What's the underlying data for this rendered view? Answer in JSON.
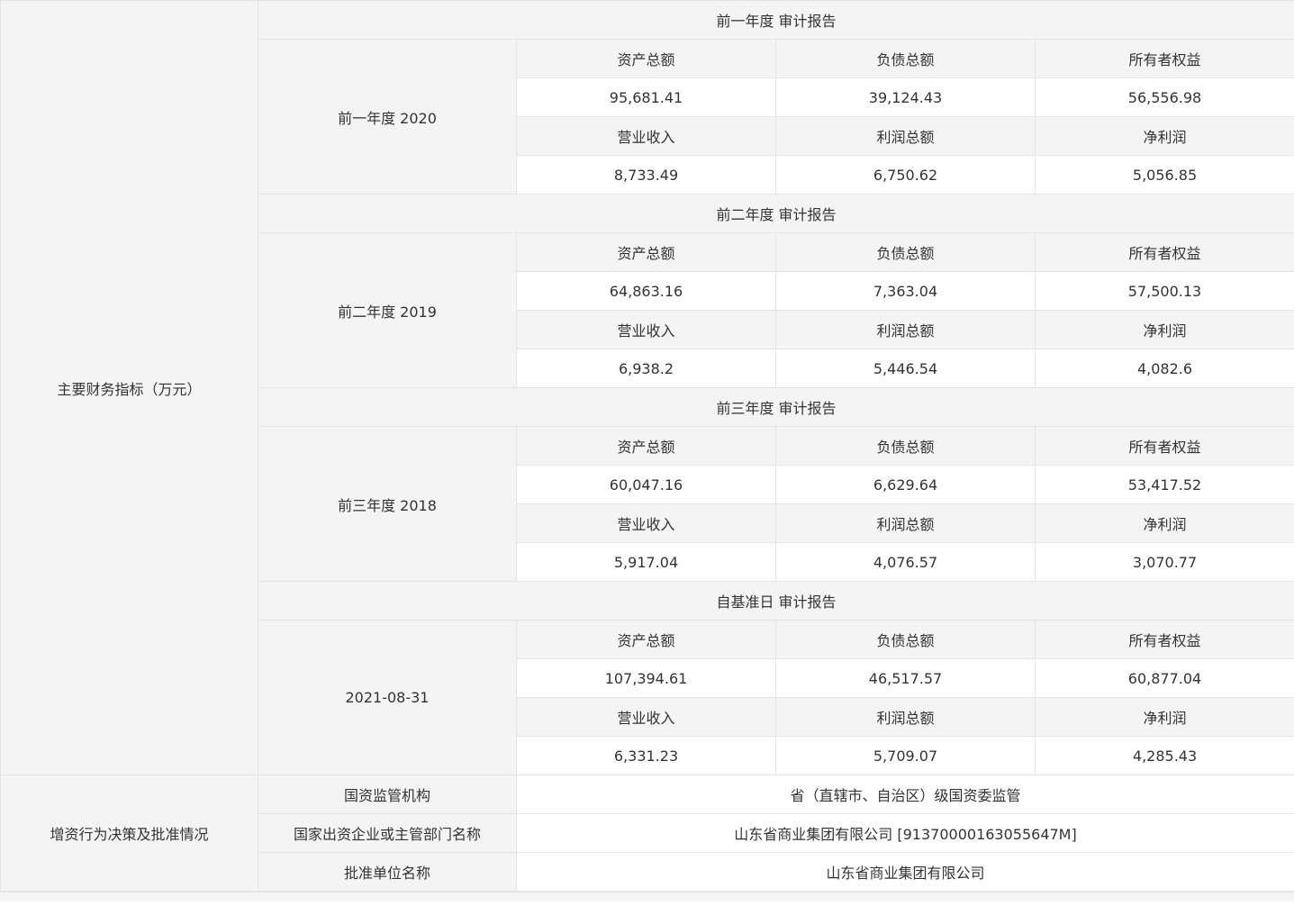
{
  "main_label": "主要财务指标（万元）",
  "metric_labels": {
    "total_assets": "资产总额",
    "total_liabilities": "负债总额",
    "owners_equity": "所有者权益",
    "revenue": "营业收入",
    "total_profit": "利润总额",
    "net_profit": "净利润"
  },
  "periods": [
    {
      "header": "前一年度 审计报告",
      "period_label": "前一年度 2020",
      "total_assets": "95,681.41",
      "total_liabilities": "39,124.43",
      "owners_equity": "56,556.98",
      "revenue": "8,733.49",
      "total_profit": "6,750.62",
      "net_profit": "5,056.85"
    },
    {
      "header": "前二年度 审计报告",
      "period_label": "前二年度 2019",
      "total_assets": "64,863.16",
      "total_liabilities": "7,363.04",
      "owners_equity": "57,500.13",
      "revenue": "6,938.2",
      "total_profit": "5,446.54",
      "net_profit": "4,082.6"
    },
    {
      "header": "前三年度 审计报告",
      "period_label": "前三年度 2018",
      "total_assets": "60,047.16",
      "total_liabilities": "6,629.64",
      "owners_equity": "53,417.52",
      "revenue": "5,917.04",
      "total_profit": "4,076.57",
      "net_profit": "3,070.77"
    },
    {
      "header": "自基准日 审计报告",
      "period_label": "2021-08-31",
      "total_assets": "107,394.61",
      "total_liabilities": "46,517.57",
      "owners_equity": "60,877.04",
      "revenue": "6,331.23",
      "total_profit": "5,709.07",
      "net_profit": "4,285.43"
    }
  ],
  "approval": {
    "section_label": "增资行为决策及批准情况",
    "rows": [
      {
        "label": "国资监管机构",
        "value": "省（直辖市、自治区）级国资委监管"
      },
      {
        "label": "国家出资企业或主管部门名称",
        "value": "山东省商业集团有限公司 [91370000163055647M]"
      },
      {
        "label": "批准单位名称",
        "value": "山东省商业集团有限公司"
      }
    ]
  }
}
